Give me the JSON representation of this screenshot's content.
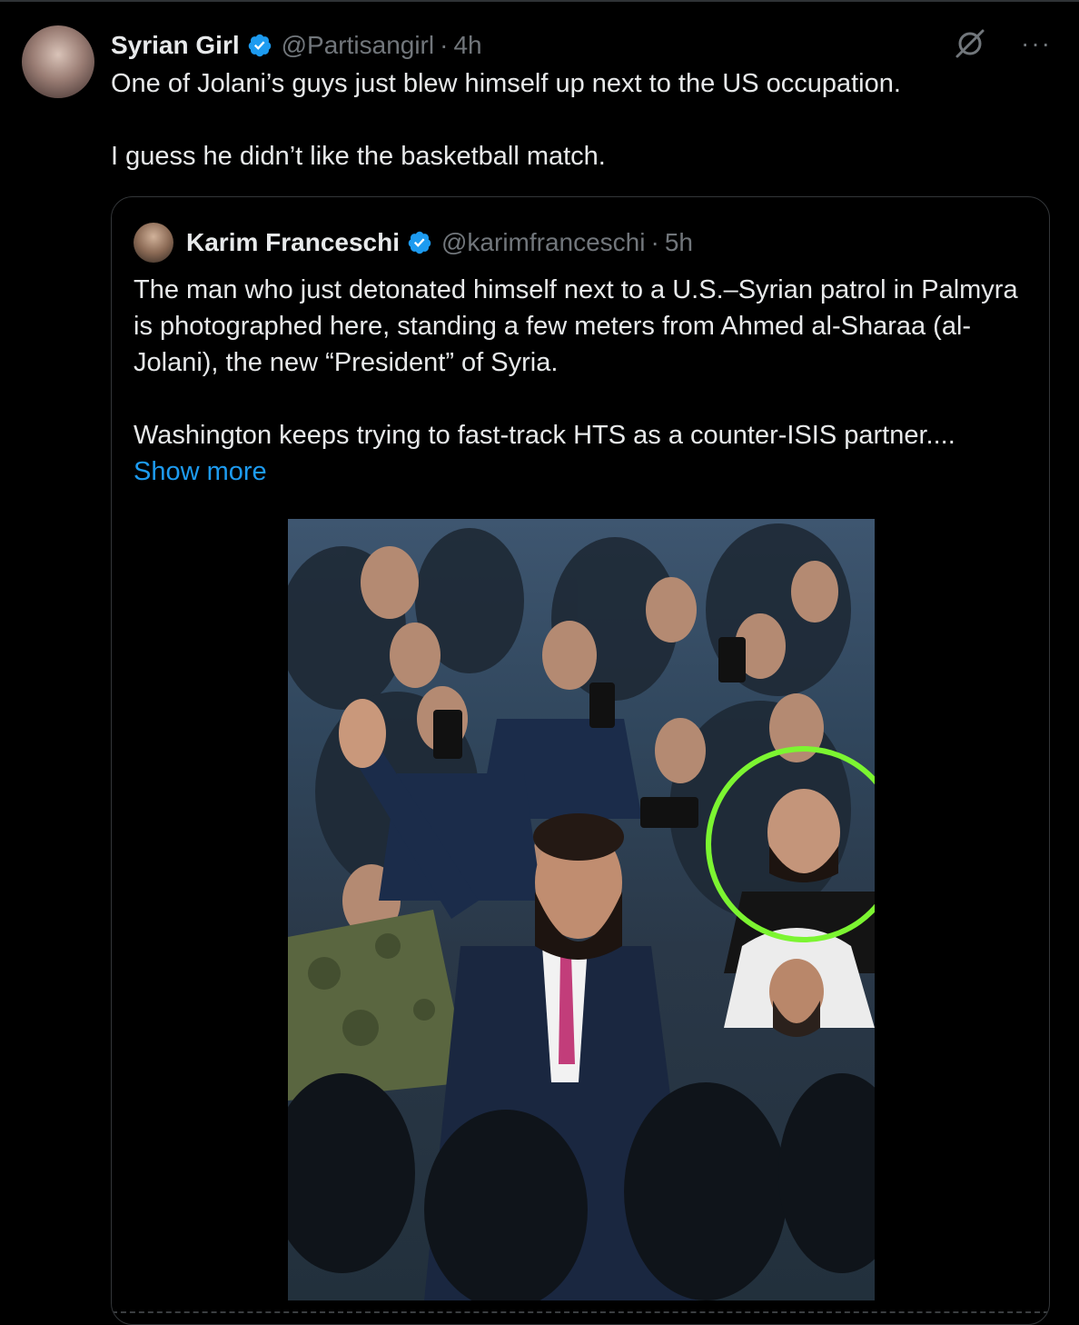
{
  "tweet": {
    "author": {
      "display_name": "Syrian Girl",
      "handle": "@Partisangirl",
      "separator": "·",
      "time": "4h",
      "verified": true
    },
    "text_lines": [
      "One of Jolani’s guys just blew himself up next to the US occupation.",
      "I guess he didn’t like the basketball match."
    ],
    "actions": {
      "grok_icon": "grok-icon",
      "more_label": "···"
    }
  },
  "quote": {
    "author": {
      "display_name": "Karim Franceschi",
      "handle": "@karimfranceschi",
      "separator": "·",
      "time": "5h",
      "verified": true
    },
    "paragraphs": [
      "The man who just detonated himself next to a U.S.–Syrian patrol in Palmyra is photographed here, standing a few meters from Ahmed al-Sharaa (al-Jolani), the new “President” of Syria.",
      "Washington keeps trying to fast-track HTS as a counter-ISIS partner...."
    ],
    "show_more": "Show more"
  },
  "colors": {
    "background": "#000000",
    "text": "#e7e9ea",
    "secondary": "#71767b",
    "accent": "#1d9bf0",
    "card_border": "#333639",
    "highlight_circle": "#7cf531"
  }
}
